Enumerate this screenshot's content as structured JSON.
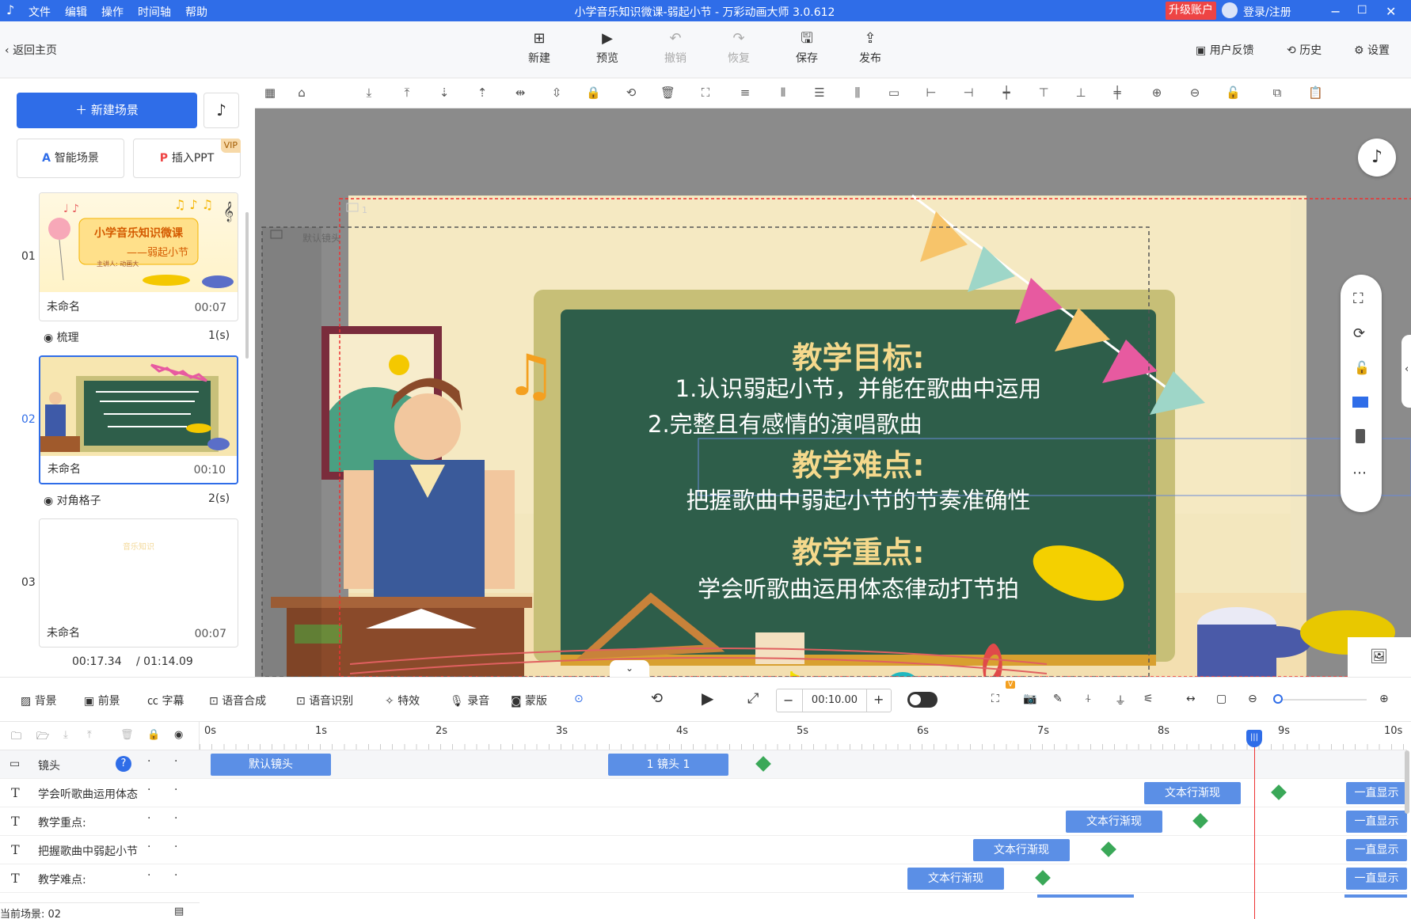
{
  "titlebar": {
    "menus": [
      "文件",
      "编辑",
      "操作",
      "时间轴",
      "帮助"
    ],
    "title": "小学音乐知识微课-弱起小节 - 万彩动画大师 3.0.612",
    "upgrade": "升级账户",
    "login": "登录/注册"
  },
  "toolbar": {
    "back": "返回主页",
    "buttons": [
      "新建",
      "预览",
      "撤销",
      "恢复",
      "保存",
      "发布"
    ],
    "feedback": "用户反馈",
    "history": "历史",
    "settings": "设置"
  },
  "left": {
    "new_scene": "新建场景",
    "smart_scene": "智能场景",
    "insert_ppt": "插入PPT",
    "vip": "VIP",
    "scenes": [
      {
        "num": "01",
        "name": "未命名",
        "dur": "00:07",
        "thumb_title": "小学音乐知识微课",
        "thumb_sub": "——弱起小节",
        "thumb_author": "主讲人: 动画大"
      },
      {
        "num": "02",
        "name": "未命名",
        "dur": "00:10"
      },
      {
        "num": "03",
        "name": "未命名",
        "dur": "00:07",
        "thumb_title": "音乐知识"
      }
    ],
    "transitions": [
      {
        "name": "梳理",
        "dur": "1(s)"
      },
      {
        "name": "对角格子",
        "dur": "2(s)"
      }
    ],
    "time_current": "00:17.34",
    "time_total": "/ 01:14.09"
  },
  "canvas": {
    "camera_label": "默认镜头",
    "camera_num": "1",
    "board": {
      "h1": "教学目标:",
      "l1": "1.认识弱起小节，并能在歌曲中运用",
      "l2": "2.完整且有感情的演唱歌曲",
      "h2": "教学难点:",
      "l3": "把握歌曲中弱起小节的节奏准确性",
      "h3": "教学重点:",
      "l4": "学会听歌曲运用体态律动打节拍"
    }
  },
  "bottom_toolbar": {
    "tools": [
      "背景",
      "前景",
      "字幕",
      "语音合成",
      "语音识别",
      "特效",
      "录音",
      "蒙版"
    ],
    "duration": "00:10.00"
  },
  "timeline": {
    "ruler": [
      "0s",
      "1s",
      "2s",
      "3s",
      "4s",
      "5s",
      "6s",
      "7s",
      "8s",
      "9s",
      "10s"
    ],
    "tracks": [
      {
        "label": "镜头",
        "clips": [
          {
            "text": "默认镜头"
          },
          {
            "text": "1 镜头 1"
          }
        ]
      },
      {
        "label": "学会听歌曲运用体态",
        "clips": [
          {
            "text": "文本行渐现"
          },
          {
            "text": "一直显示"
          }
        ]
      },
      {
        "label": "教学重点:",
        "clips": [
          {
            "text": "文本行渐现"
          },
          {
            "text": "一直显示"
          }
        ]
      },
      {
        "label": "把握歌曲中弱起小节",
        "clips": [
          {
            "text": "文本行渐现"
          },
          {
            "text": "一直显示"
          }
        ]
      },
      {
        "label": "教学难点:",
        "clips": [
          {
            "text": "文本行渐现"
          },
          {
            "text": "一直显示"
          }
        ]
      }
    ],
    "current_scene": "当前场景: 02"
  }
}
